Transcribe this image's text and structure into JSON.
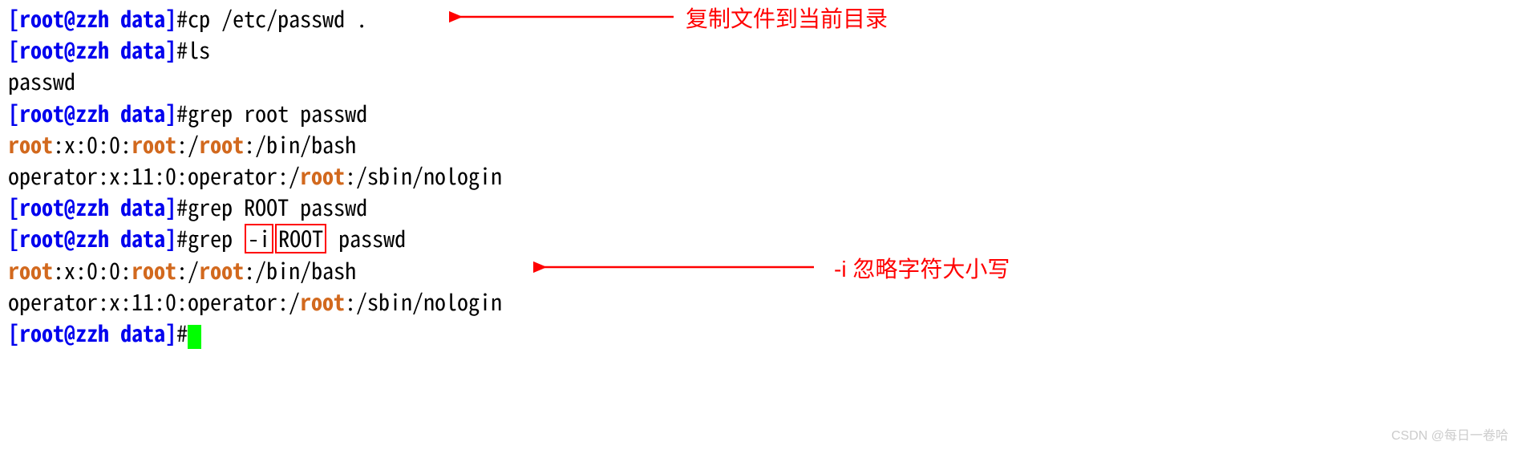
{
  "prompt": {
    "open": "[",
    "user": "root",
    "at": "@",
    "host": "zzh",
    "space": " ",
    "path": "data",
    "close": "]",
    "hash": "#"
  },
  "lines": {
    "cmd1": "cp /etc/passwd .",
    "cmd2": "ls",
    "out2": "passwd",
    "cmd3": "grep root passwd",
    "out3a_p1": "root",
    "out3a_p2": ":x:0:0:",
    "out3a_p3": "root",
    "out3a_p4": ":/",
    "out3a_p5": "root",
    "out3a_p6": ":/bin/bash",
    "out3b_p1": "operator:x:11:0:operator:/",
    "out3b_p2": "root",
    "out3b_p3": ":/sbin/nologin",
    "cmd4": "grep ROOT passwd",
    "cmd5_p1": "grep ",
    "cmd5_box1": "-i",
    "cmd5_mid": " ",
    "cmd5_box2": "ROOT",
    "cmd5_p2": " passwd",
    "out5a_p1": "root",
    "out5a_p2": ":x:0:0:",
    "out5a_p3": "root",
    "out5a_p4": ":/",
    "out5a_p5": "root",
    "out5a_p6": ":/bin/bash",
    "out5b_p1": "operator:x:11:0:operator:/",
    "out5b_p2": "root",
    "out5b_p3": ":/sbin/nologin"
  },
  "annotations": {
    "note1": "复制文件到当前目录",
    "note2": "-i 忽略字符大小写"
  },
  "watermark": "CSDN @每日一卷哈"
}
